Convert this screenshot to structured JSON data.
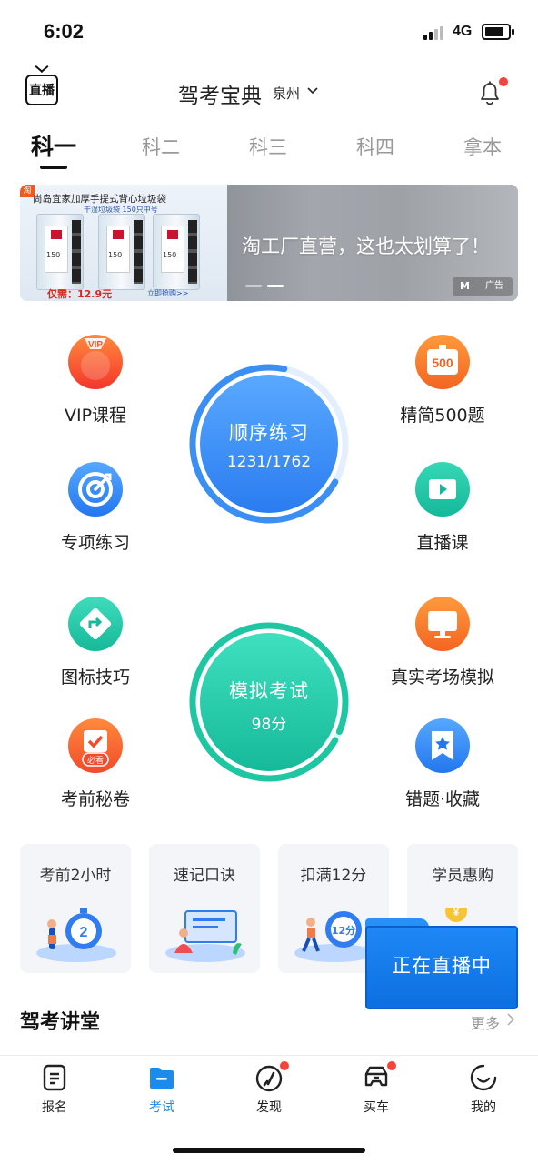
{
  "status": {
    "time": "6:02",
    "network": "4G"
  },
  "header": {
    "title": "驾考宝典",
    "city": "泉州",
    "live_logo": "直播",
    "live_logo_icon": "live-tv-icon",
    "notification_icon": "bell-icon",
    "has_notification": true
  },
  "subject_tabs": [
    {
      "label": "科一",
      "active": true
    },
    {
      "label": "科二",
      "active": false
    },
    {
      "label": "科三",
      "active": false
    },
    {
      "label": "科四",
      "active": false
    },
    {
      "label": "拿本",
      "active": false
    }
  ],
  "banner": {
    "product_headline": "尚岛宜家加厚手提式背心垃圾袋",
    "product_sub": "干湿垃圾袋 150只中号",
    "product_count": "150",
    "price": "仅需：12.9元",
    "buy": "立即抢购>>",
    "taobao_badge": "淘",
    "slogan": "淘工厂直营，这也太划算了！",
    "ad_label": "广告",
    "dots_total": 2,
    "dots_active": 2
  },
  "functions_top": {
    "left": [
      {
        "label": "VIP课程",
        "icon": "vip-icon"
      },
      {
        "label": "专项练习",
        "icon": "target-icon"
      }
    ],
    "right": [
      {
        "label": "精简500题",
        "icon": "500-icon",
        "badge": "500"
      },
      {
        "label": "直播课",
        "icon": "video-play-icon"
      }
    ],
    "center": {
      "title": "顺序练习",
      "value": "1231/1762",
      "done": 1231,
      "total": 1762
    }
  },
  "functions_bottom": {
    "left": [
      {
        "label": "图标技巧",
        "icon": "road-sign-icon"
      },
      {
        "label": "考前秘卷",
        "icon": "clipboard-check-icon",
        "badge": "必看"
      }
    ],
    "right": [
      {
        "label": "真实考场模拟",
        "icon": "monitor-icon"
      },
      {
        "label": "错题·收藏",
        "icon": "bookmark-star-icon"
      }
    ],
    "center": {
      "title": "模拟考试",
      "value": "98分",
      "score": 98,
      "max": 100
    }
  },
  "cards": [
    {
      "title": "考前2小时",
      "icon": "stopwatch-icon",
      "illus_text": "2"
    },
    {
      "title": "速记口诀",
      "icon": "reading-icon"
    },
    {
      "title": "扣满12分",
      "icon": "clock-12-icon",
      "illus_text": "12分"
    },
    {
      "title": "学员惠购",
      "icon": "coin-icon",
      "illus_text": "¥"
    }
  ],
  "live_float": {
    "label": "正在直播中"
  },
  "section": {
    "title": "驾考讲堂",
    "more": "更多"
  },
  "bottom_nav": [
    {
      "label": "报名",
      "icon": "document-icon",
      "active": false,
      "dot": false
    },
    {
      "label": "考试",
      "icon": "folder-icon",
      "active": true,
      "dot": false
    },
    {
      "label": "发现",
      "icon": "compass-icon",
      "active": false,
      "dot": true
    },
    {
      "label": "买车",
      "icon": "car-icon",
      "active": false,
      "dot": true
    },
    {
      "label": "我的",
      "icon": "smile-icon",
      "active": false,
      "dot": false
    }
  ],
  "colors": {
    "accent": "#1a8cf0",
    "badge_red": "#f4433a",
    "practice_blue": "#3b8ef2",
    "exam_green": "#1ec7a2"
  }
}
